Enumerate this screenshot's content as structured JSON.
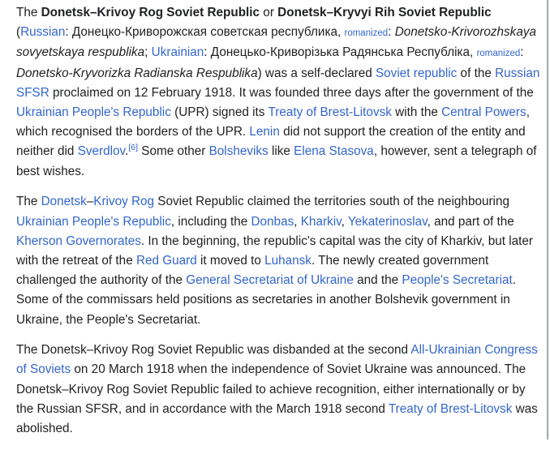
{
  "p1": {
    "t1": "The ",
    "b1": "Donetsk–Krivoy Rog Soviet Republic",
    "t2": " or ",
    "b2": "Donetsk–Kryvyi Rih Soviet Republic",
    "t3": " (",
    "l_russian": "Russian",
    "t4": ": Донецко-Криворожская советская республика, ",
    "l_romanized1": "romanized",
    "t5": ": ",
    "i1": "Donetsko-Krivorozhskaya sovyetskaya respublika",
    "t6": "; ",
    "l_ukrainian": "Ukrainian",
    "t7": ": Донецько-Криворізька Радянська Республіка, ",
    "l_romanized2": "romanized",
    "t8": ": ",
    "i2": "Donetsko-Kryvorizka Radianska Respublika",
    "t9": ") was a self-declared ",
    "l_soviet_republic": "Soviet republic",
    "t10": " of the ",
    "l_russian_sfsr": "Russian SFSR",
    "t11": " proclaimed on 12 February 1918. It was founded three days after the government of the ",
    "l_upr": "Ukrainian People's Republic",
    "t12": " (UPR) signed its ",
    "l_treaty": "Treaty of Brest-Litovsk",
    "t13": " with the ",
    "l_central_powers": "Central Powers",
    "t14": ", which recognised the borders of the UPR. ",
    "l_lenin": "Lenin",
    "t15": " did not support the creation of the entity and neither did ",
    "l_sverdlov": "Sverdlov",
    "t16": ".",
    "ref6": "[6]",
    "t17": " Some other ",
    "l_bolsheviks": "Bolsheviks",
    "t18": " like ",
    "l_stasova": "Elena Stasova",
    "t19": ", however, sent a telegraph of best wishes."
  },
  "p2": {
    "t1": "The ",
    "l_donetsk": "Donetsk",
    "t2": "–",
    "l_krivoy_rog": "Krivoy Rog",
    "t3": " Soviet Republic claimed the territories south of the neighbouring ",
    "l_upr": "Ukrainian People's Republic",
    "t4": ", including the ",
    "l_donbas": "Donbas",
    "t5": ", ",
    "l_kharkiv": "Kharkiv",
    "t6": ", ",
    "l_yekaterinoslav": "Yekaterinoslav",
    "t7": ", and part of the ",
    "l_kherson": "Kherson Governorates",
    "t8": ". In the beginning, the republic's capital was the city of Kharkiv, but later with the retreat of the ",
    "l_red_guard": "Red Guard",
    "t9": " it moved to ",
    "l_luhansk": "Luhansk",
    "t10": ". The newly created government challenged the authority of the ",
    "l_gen_sec": "General Secretariat of Ukraine",
    "t11": " and the ",
    "l_peoples_sec": "People's Secretariat",
    "t12": ". Some of the commissars held positions as secretaries in another Bolshevik government in Ukraine, the People's Secretariat."
  },
  "p3": {
    "t1": "The Donetsk–Krivoy Rog Soviet Republic was disbanded at the second ",
    "l_congress": "All-Ukrainian Congress of Soviets",
    "t2": " on 20 March 1918 when the independence of Soviet Ukraine was announced. The Donetsk–Krivoy Rog Soviet Republic failed to achieve recognition, either internationally or by the Russian SFSR, and in accordance with the March 1918 second ",
    "l_treaty": "Treaty of Brest-Litovsk",
    "t3": " was abolished."
  },
  "colors": {
    "text": "#202122",
    "link": "#3366cc",
    "border": "#a2a9b1",
    "background": "#ffffff"
  }
}
